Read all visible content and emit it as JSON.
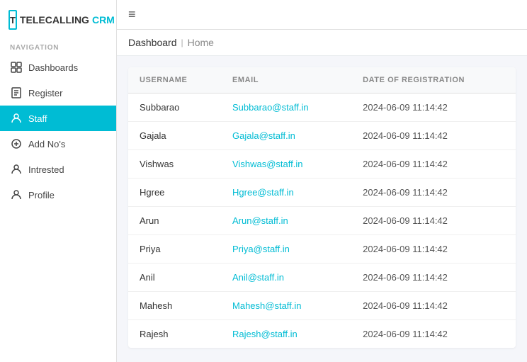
{
  "logo": {
    "icon_letter": "T",
    "text_tele": "TELECALLING",
    "text_crm": "CRM"
  },
  "sidebar": {
    "nav_label": "NAVIGATION",
    "items": [
      {
        "id": "dashboards",
        "label": "Dashboards",
        "icon": "dashboard",
        "active": false
      },
      {
        "id": "register",
        "label": "Register",
        "icon": "register",
        "active": false
      },
      {
        "id": "staff",
        "label": "Staff",
        "icon": "staff",
        "active": true
      },
      {
        "id": "add-nos",
        "label": "Add No's",
        "icon": "add",
        "active": false
      },
      {
        "id": "intrested",
        "label": "Intrested",
        "icon": "person",
        "active": false
      },
      {
        "id": "profile",
        "label": "Profile",
        "icon": "profile",
        "active": false
      }
    ]
  },
  "topbar": {
    "menu_icon": "≡"
  },
  "breadcrumb": {
    "active": "Dashboard",
    "separator": "|",
    "link": "Home"
  },
  "table": {
    "columns": [
      {
        "id": "username",
        "label": "USERNAME"
      },
      {
        "id": "email",
        "label": "EMAIL"
      },
      {
        "id": "date",
        "label": "DATE OF REGISTRATION"
      }
    ],
    "rows": [
      {
        "username": "Subbarao",
        "email": "Subbarao@staff.in",
        "date": "2024-06-09 11:14:42"
      },
      {
        "username": "Gajala",
        "email": "Gajala@staff.in",
        "date": "2024-06-09 11:14:42"
      },
      {
        "username": "Vishwas",
        "email": "Vishwas@staff.in",
        "date": "2024-06-09 11:14:42"
      },
      {
        "username": "Hgree",
        "email": "Hgree@staff.in",
        "date": "2024-06-09 11:14:42"
      },
      {
        "username": "Arun",
        "email": "Arun@staff.in",
        "date": "2024-06-09 11:14:42"
      },
      {
        "username": "Priya",
        "email": "Priya@staff.in",
        "date": "2024-06-09 11:14:42"
      },
      {
        "username": "Anil",
        "email": "Anil@staff.in",
        "date": "2024-06-09 11:14:42"
      },
      {
        "username": "Mahesh",
        "email": "Mahesh@staff.in",
        "date": "2024-06-09 11:14:42"
      },
      {
        "username": "Rajesh",
        "email": "Rajesh@staff.in",
        "date": "2024-06-09 11:14:42"
      }
    ]
  }
}
